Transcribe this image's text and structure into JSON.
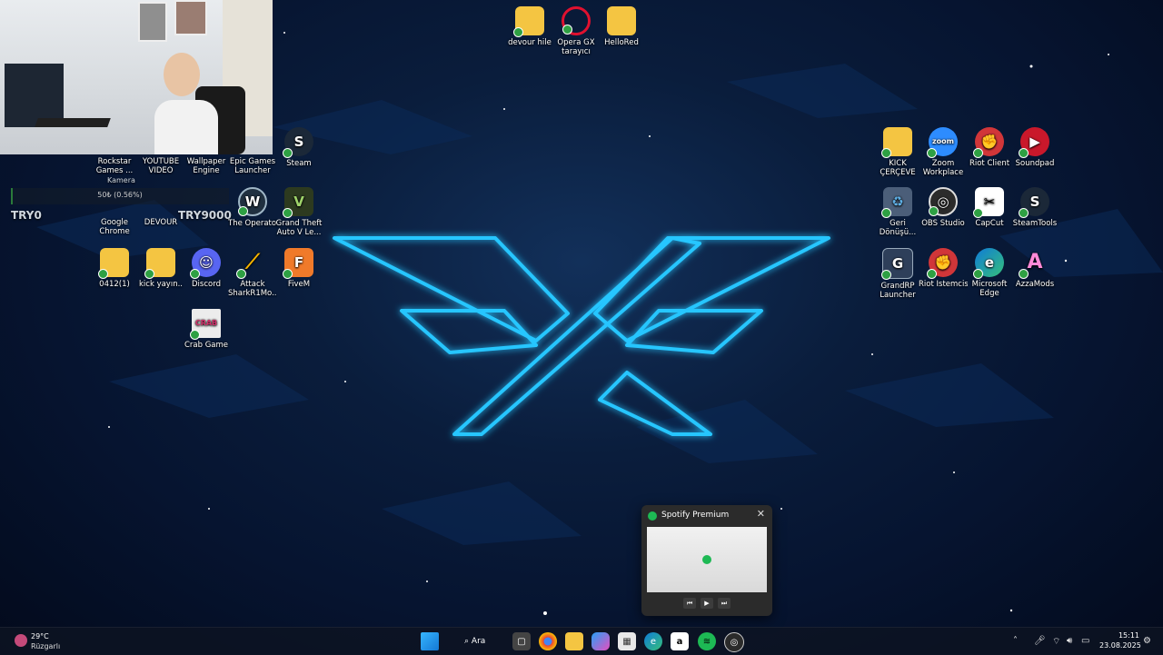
{
  "webcam": {
    "label": "Kamera"
  },
  "overlay": {
    "progress_text": "50₺ (0.56%)",
    "progress_fraction": 0.0056,
    "left_text": "TRY0",
    "right_text": "TRY9000"
  },
  "desktop_icons": {
    "devour_hile": "devour hile",
    "opera_gx": "Opera GX\ntarayıcı",
    "hellored": "HelloRed",
    "rockstar": "Rockstar\nGames ...",
    "youtube_video": "YOUTUBE\nVIDEO",
    "wallpaper_engine": "Wallpaper\nEngine",
    "epic_games": "Epic Games\nLauncher",
    "steam": "Steam",
    "google_chrome": "Google\nChrome",
    "devour": "DEVOUR",
    "the_operator": "The Operator",
    "gta5": "Grand Theft\nAuto V Le...",
    "folder_0412": "0412(1)",
    "kick_yayin": "kick yayın..",
    "discord": "Discord",
    "attack_shark": "Attack\nSharkR1Mo...",
    "fivem": "FiveM",
    "crab_game": "Crab Game",
    "kick_cerceve": "KICK\nÇERÇEVE",
    "zoom": "Zoom\nWorkplace",
    "riot_client": "Riot Client",
    "soundpad": "Soundpad",
    "recycle_bin": "Geri\nDönüşü...",
    "obs_studio": "OBS Studio",
    "capcut": "CapCut",
    "steamtools": "SteamTools",
    "grandrp": "GrandRP\nLauncher",
    "riot_istemcisi": "Riot İstemcisi",
    "microsoft_edge": "Microsoft\nEdge",
    "azzamods": "AzzaMods"
  },
  "spotify_flyout": {
    "title": "Spotify Premium"
  },
  "taskbar": {
    "search_label": "Ara",
    "weather_temp": "29°C",
    "weather_desc": "Rüzgarlı",
    "time": "15:11",
    "date": "23.08.2025"
  },
  "colors": {
    "accent_neon": "#27c6ff",
    "spotify_green": "#1db954"
  }
}
